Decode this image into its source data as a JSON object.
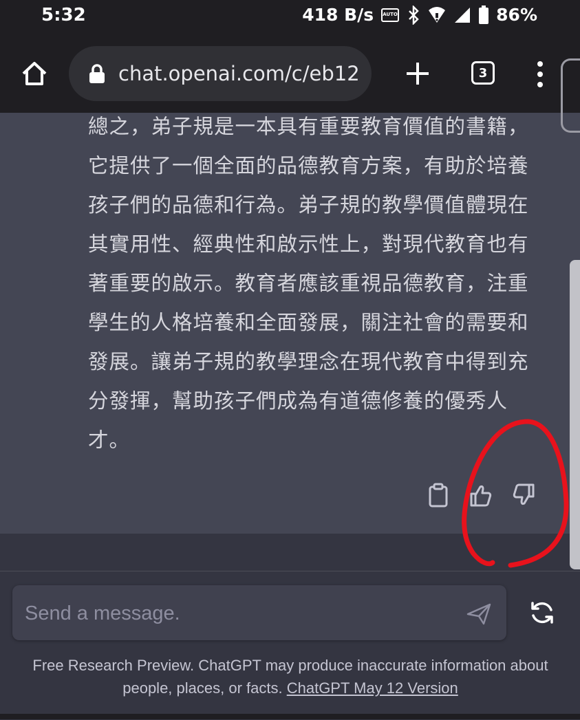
{
  "status_bar": {
    "time": "5:32",
    "net_speed": "418 B/s",
    "battery": "86%",
    "icons": [
      "auto-hz-icon",
      "bluetooth-icon",
      "wifi-icon",
      "signal-icon",
      "battery-icon"
    ]
  },
  "browser": {
    "url": "chat.openai.com/c/eb12",
    "tab_count": "3",
    "icons": [
      "home-icon",
      "lock-icon",
      "plus-icon",
      "tabs-icon",
      "more-vert-icon"
    ]
  },
  "message": {
    "text": "總之，弟子規是一本具有重要教育價值的書籍，它提供了一個全面的品德教育方案，有助於培養孩子們的品德和行為。弟子規的教學價值體現在其實用性、經典性和啟示性上，對現代教育也有著重要的啟示。教育者應該重視品德教育，注重學生的人格培養和全面發展，關注社會的需要和發展。讓弟子規的教學理念在現代教育中得到充分發揮，幫助孩子們成為有道德修養的優秀人才。",
    "action_icons": [
      "clipboard-icon",
      "thumbs-up-icon",
      "thumbs-down-icon"
    ]
  },
  "composer": {
    "placeholder": "Send a message.",
    "icons": [
      "send-icon",
      "regenerate-icon"
    ]
  },
  "footer": {
    "disclaimer": "Free Research Preview. ChatGPT may produce inaccurate information about people, places, or facts.",
    "version_link": "ChatGPT May 12 Version"
  },
  "colors": {
    "message_bg": "#444654",
    "page_bg": "#343541",
    "annotation": "#e8121c"
  }
}
